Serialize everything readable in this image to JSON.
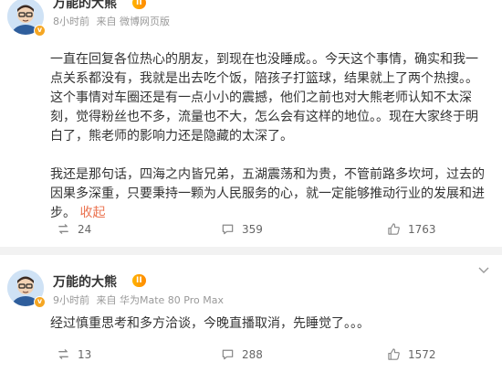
{
  "posts": [
    {
      "author": "万能的大熊",
      "level": "II",
      "verified": "v",
      "time": "8小时前",
      "source": "来自 微博网页版",
      "paragraphs": [
        "一直在回复各位热心的朋友，到现在也没睡成。。今天这个事情，确实和我一点关系都没有，我就是出去吃个饭，陪孩子打篮球，结果就上了两个热搜。。这个事情对车圈还是有一点小小的震撼，他们之前也对大熊老师认知不太深刻，觉得粉丝也不多，流量也不大，怎么会有这样的地位。。现在大家终于明白了，熊老师的影响力还是隐藏的太深了。",
        "我还是那句话，四海之内皆兄弟，五湖震荡和为贵，不管前路多坎坷，过去的因果多深重，只要秉持一颗为人民服务的心，就一定能够推动行业的发展和进步。"
      ],
      "collapse": "收起",
      "reposts": "24",
      "comments": "359",
      "likes": "1763"
    },
    {
      "author": "万能的大熊",
      "level": "II",
      "verified": "v",
      "time": "9小时前",
      "source": "来自 华为Mate 80 Pro Max",
      "paragraphs": [
        "经过慎重思考和多方洽谈，今晚直播取消，先睡觉了。。。"
      ],
      "reposts": "13",
      "comments": "288",
      "likes": "1572"
    }
  ],
  "colors": {
    "accent": "#eb7350",
    "level_badge": "#ff9a00",
    "verified": "#f5a623"
  },
  "icons": {
    "repost": "repost-icon",
    "comment": "comment-icon",
    "like": "like-icon",
    "menu": "chevron-down-icon"
  }
}
